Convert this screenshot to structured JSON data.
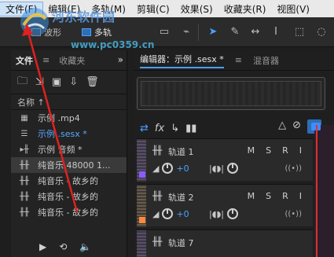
{
  "menu": [
    "文件(F)",
    "编辑(E)",
    "多轨(M)",
    "剪辑(C)",
    "效果(S)",
    "收藏夹(R)",
    "视图(V)"
  ],
  "toolbar": {
    "waveform_label": "波形",
    "multitrack_label": "多轨"
  },
  "watermark": {
    "text": "河东软件园",
    "url": "www.pc0359.cn"
  },
  "left_panel": {
    "tabs": [
      "文件",
      "收藏夹"
    ],
    "column_header": "名称 ↑",
    "files": [
      {
        "name": "示例 .mp4",
        "icon": "video-icon",
        "selected": false
      },
      {
        "name": "示例 .sesx *",
        "icon": "multitrack-icon",
        "selected": true
      },
      {
        "name": "示例   音频 *",
        "icon": "audio-icon",
        "selected": false
      },
      {
        "name": "纯音乐 48000 1...",
        "icon": "audio-icon",
        "selected": false,
        "highlighted": true
      },
      {
        "name": "纯音乐 - 故乡的",
        "icon": "audio-icon",
        "selected": false
      },
      {
        "name": "纯音乐 - 故乡的",
        "icon": "audio-icon",
        "selected": false
      },
      {
        "name": "纯音乐 - 故乡的",
        "icon": "audio-icon",
        "selected": false
      }
    ]
  },
  "editor": {
    "tabs": [
      "编辑器：示例 .sesx *",
      "混音器"
    ],
    "tracks": [
      {
        "name": "轨道 1",
        "volume": "+0",
        "color": "#8a5cff"
      },
      {
        "name": "轨道 2",
        "volume": "+0",
        "color": "#ff8a3a"
      },
      {
        "name": "轨道 7",
        "volume": "",
        "color": "#8a5cff"
      }
    ],
    "track_buttons": [
      "M",
      "S",
      "R",
      "I"
    ]
  },
  "colors": {
    "accent": "#4aa0ff",
    "playhead": "#e03030",
    "arrow": "#e02020"
  }
}
